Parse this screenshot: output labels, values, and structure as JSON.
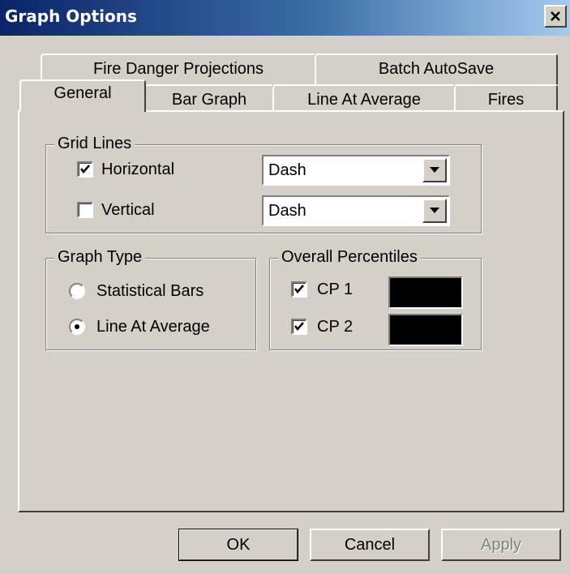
{
  "window": {
    "title": "Graph Options",
    "close_icon": "close-icon"
  },
  "tabs": {
    "row_back": [
      "Fire Danger Projections",
      "Batch AutoSave"
    ],
    "row_front": [
      "General",
      "Bar Graph",
      "Line At Average",
      "Fires"
    ],
    "active": "General"
  },
  "grid_lines": {
    "title": "Grid Lines",
    "horizontal": {
      "label": "Horizontal",
      "checked": true,
      "style": "Dash"
    },
    "vertical": {
      "label": "Vertical",
      "checked": false,
      "style": "Dash"
    }
  },
  "graph_type": {
    "title": "Graph Type",
    "options": [
      "Statistical Bars",
      "Line At Average"
    ],
    "selected": "Line At Average"
  },
  "overall_percentiles": {
    "title": "Overall Percentiles",
    "cp1": {
      "label": "CP 1",
      "checked": true,
      "color": "#000000"
    },
    "cp2": {
      "label": "CP 2",
      "checked": true,
      "color": "#000000"
    }
  },
  "buttons": {
    "ok": "OK",
    "cancel": "Cancel",
    "apply": "Apply"
  }
}
